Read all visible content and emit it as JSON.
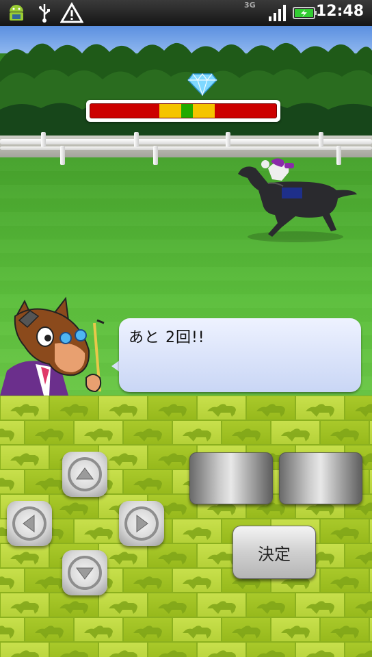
{
  "status_bar": {
    "time": "12:48",
    "network": "3G",
    "icons": [
      "android-icon",
      "usb-icon",
      "warning-icon",
      "signal-icon",
      "battery-icon"
    ]
  },
  "game": {
    "meter": {
      "segments": [
        {
          "color": "#cc0000",
          "from": 0.0,
          "to": 0.37
        },
        {
          "color": "#f5c400",
          "from": 0.37,
          "to": 0.49
        },
        {
          "color": "#22aa00",
          "from": 0.49,
          "to": 0.55
        },
        {
          "color": "#f5c400",
          "from": 0.55,
          "to": 0.67
        },
        {
          "color": "#cc0000",
          "from": 0.67,
          "to": 1.0
        }
      ],
      "marker_icon": "diamond-icon"
    },
    "dialogue": {
      "text": "あと 2回!!"
    }
  },
  "controls": {
    "dpad_up": "up-arrow-icon",
    "dpad_down": "down-arrow-icon",
    "dpad_left": "left-arrow-icon",
    "dpad_right": "right-arrow-icon",
    "ok_label": "決定"
  }
}
